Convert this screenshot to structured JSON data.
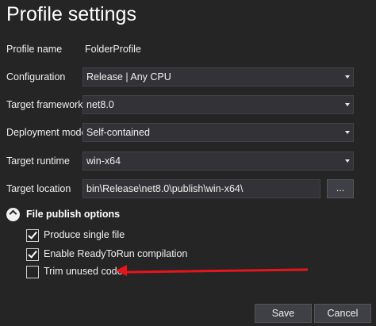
{
  "title": "Profile settings",
  "fields": {
    "profile_name_label": "Profile name",
    "profile_name_value": "FolderProfile",
    "configuration_label": "Configuration",
    "configuration_value": "Release | Any CPU",
    "target_framework_label": "Target framework",
    "target_framework_value": "net8.0",
    "deployment_mode_label": "Deployment mode",
    "deployment_mode_value": "Self-contained",
    "target_runtime_label": "Target runtime",
    "target_runtime_value": "win-x64",
    "target_location_label": "Target location",
    "target_location_value": "bin\\Release\\net8.0\\publish\\win-x64\\",
    "browse_label": "..."
  },
  "file_publish": {
    "section_title": "File publish options",
    "options": [
      {
        "label": "Produce single file",
        "checked": true
      },
      {
        "label": "Enable ReadyToRun compilation",
        "checked": true
      },
      {
        "label": "Trim unused code",
        "checked": false
      }
    ]
  },
  "annotation": {
    "arrow_color": "#e8141b"
  },
  "footer": {
    "save_label": "Save",
    "cancel_label": "Cancel"
  },
  "icons": {
    "toggle": "chevron-up-icon",
    "dropdown": "chevron-down-icon",
    "check": "checkmark-icon"
  }
}
